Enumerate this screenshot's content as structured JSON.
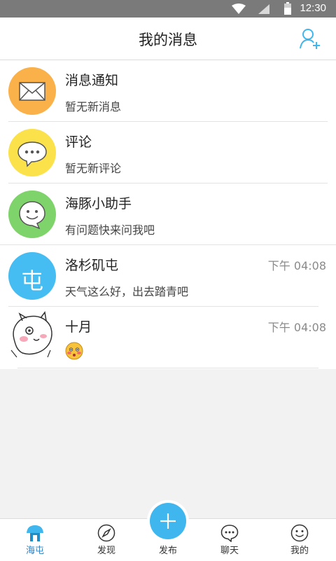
{
  "status_bar": {
    "time": "12:30"
  },
  "header": {
    "title": "我的消息",
    "add_icon": "add-friend-icon"
  },
  "messages": [
    {
      "name": "消息通知",
      "preview": "暂无新消息",
      "time": "",
      "icon": "envelope-icon",
      "color": "#fbb14a"
    },
    {
      "name": "评论",
      "preview": "暂无新评论",
      "time": "",
      "icon": "comment-icon",
      "color": "#fbe14a"
    },
    {
      "name": "海豚小助手",
      "preview": "有问题快来问我吧",
      "time": "",
      "icon": "smile-chat-icon",
      "color": "#7ed36a"
    },
    {
      "name": "洛杉矶屯",
      "preview": "天气这么好，出去踏青吧",
      "time": "下午 04:08",
      "icon": "tun-char-icon",
      "avatar_text": "屯",
      "color": "#45bdf2"
    },
    {
      "name": "十月",
      "preview": "",
      "time": "下午 04:08",
      "icon": "cartoon-avatar",
      "preview_icon": "blushing-emoji-icon"
    }
  ],
  "tabs": [
    {
      "label": "海屯",
      "icon": "mushroom-home-icon",
      "active": true
    },
    {
      "label": "发现",
      "icon": "compass-icon",
      "active": false
    },
    {
      "label": "发布",
      "icon": "plus-icon",
      "active": false
    },
    {
      "label": "聊天",
      "icon": "chat-bubble-icon",
      "active": false
    },
    {
      "label": "我的",
      "icon": "smile-face-icon",
      "active": false
    }
  ],
  "colors": {
    "accent": "#3fb7ee",
    "active_tab": "#2a7fbd"
  }
}
